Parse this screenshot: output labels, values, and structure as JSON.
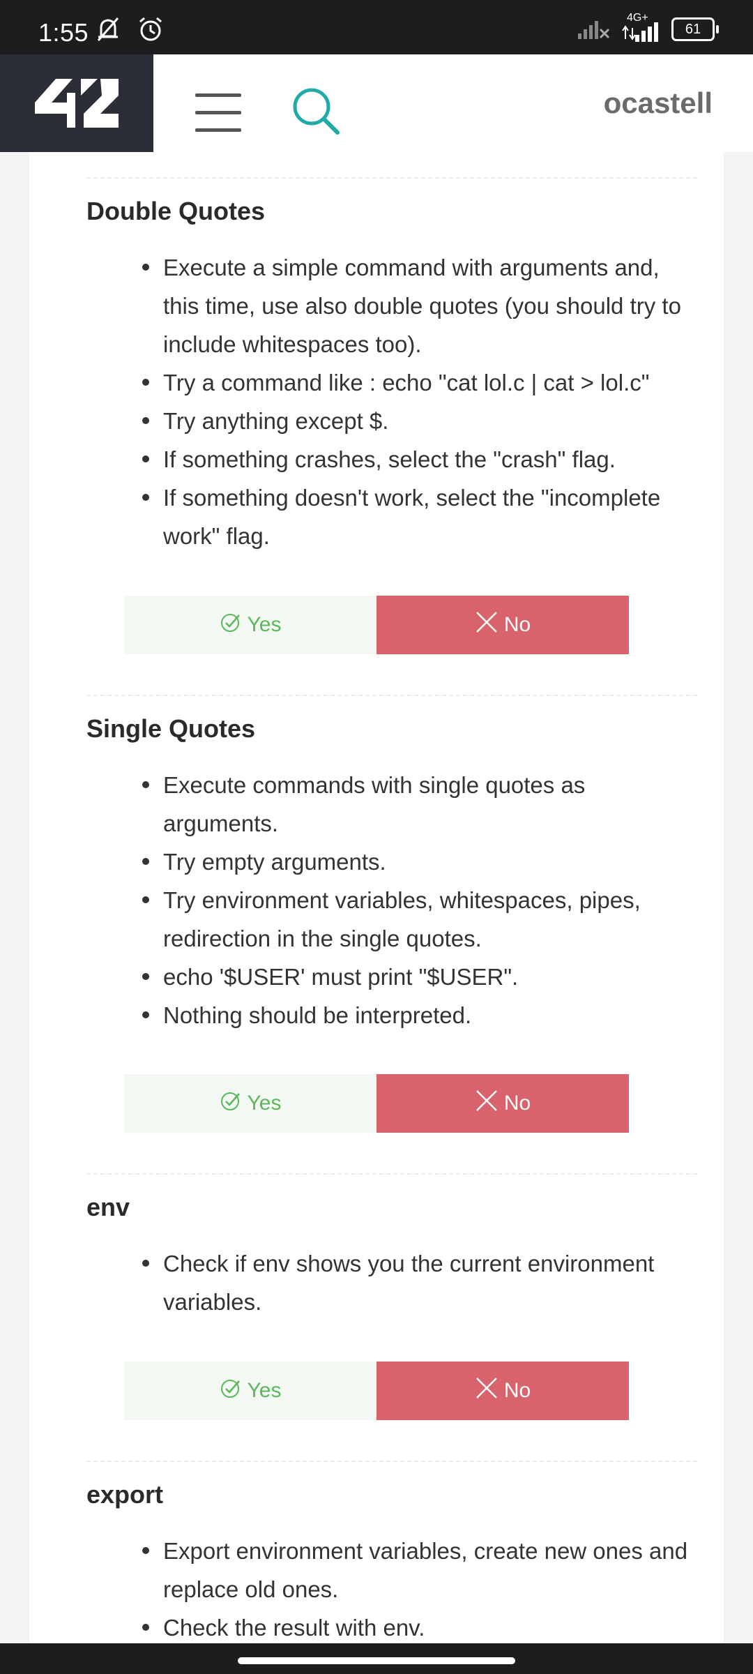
{
  "status_bar": {
    "time": "1:55",
    "network": "4G+",
    "battery": "61",
    "icons": [
      "muted-bell-icon",
      "alarm-icon",
      "signal-x-icon",
      "signal-icon",
      "battery-icon"
    ]
  },
  "header": {
    "logo_text": "42",
    "username": "ocastell",
    "icons": [
      "menu-icon",
      "search-icon"
    ]
  },
  "sections": [
    {
      "title": "Double Quotes",
      "items": [
        "Execute a simple command with arguments and, this time, use also double quotes (you should try to include whitespaces too).",
        "Try a command like : echo \"cat lol.c | cat > lol.c\"",
        "Try anything except $.",
        "If something crashes, select the \"crash\" flag.",
        "If something doesn't work, select the \"incomplete work\" flag."
      ],
      "yes_label": "Yes",
      "no_label": "No"
    },
    {
      "title": "Single Quotes",
      "items": [
        "Execute commands with single quotes as arguments.",
        "Try empty arguments.",
        "Try environment variables, whitespaces, pipes, redirection in the single quotes.",
        "echo '$USER' must print \"$USER\".",
        "Nothing should be interpreted."
      ],
      "yes_label": "Yes",
      "no_label": "No"
    },
    {
      "title": "env",
      "items": [
        "Check if env shows you the current environment variables."
      ],
      "yes_label": "Yes",
      "no_label": "No"
    },
    {
      "title": "export",
      "items": [
        "Export environment variables, create new ones and replace old ones.",
        "Check the result with env."
      ]
    }
  ],
  "colors": {
    "yes_text": "#5cb85c",
    "no_background": "#d9636c",
    "logo_background": "#2b2e37",
    "search_icon": "#20aaa8"
  }
}
